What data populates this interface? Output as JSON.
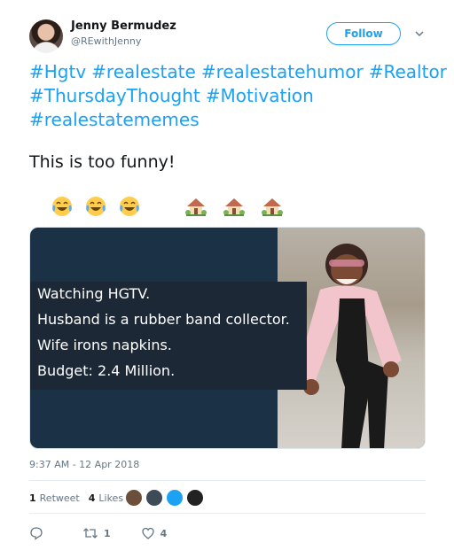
{
  "author": {
    "name": "Jenny Bermudez",
    "handle": "@REwithJenny"
  },
  "follow_label": "Follow",
  "hashtags": [
    "#Hgtv",
    "#realestate",
    "#realestatehumor",
    "#Realtor",
    "#ThursdayThought",
    "#Motivation",
    "#realestatememes"
  ],
  "tweet_text": "This is too funny!",
  "emojis": {
    "first_group": [
      "face-with-tears-of-joy",
      "face-with-tears-of-joy",
      "face-with-tears-of-joy"
    ],
    "second_group": [
      "house-with-garden",
      "house-with-garden",
      "house-with-garden"
    ]
  },
  "media": {
    "lines": [
      "Watching HGTV.",
      "Husband is a rubber band collector.",
      "Wife irons napkins.",
      "Budget: 2.4 Million."
    ]
  },
  "timestamp": "9:37 AM - 12 Apr 2018",
  "stats": {
    "retweets_count": "1",
    "retweets_label": "Retweet",
    "likes_count": "4",
    "likes_label": "Likes"
  },
  "actions": {
    "retweet_count": "1",
    "like_count": "4"
  },
  "colors": {
    "accent": "#1da1f2",
    "meme_bg": "#1b3145"
  }
}
